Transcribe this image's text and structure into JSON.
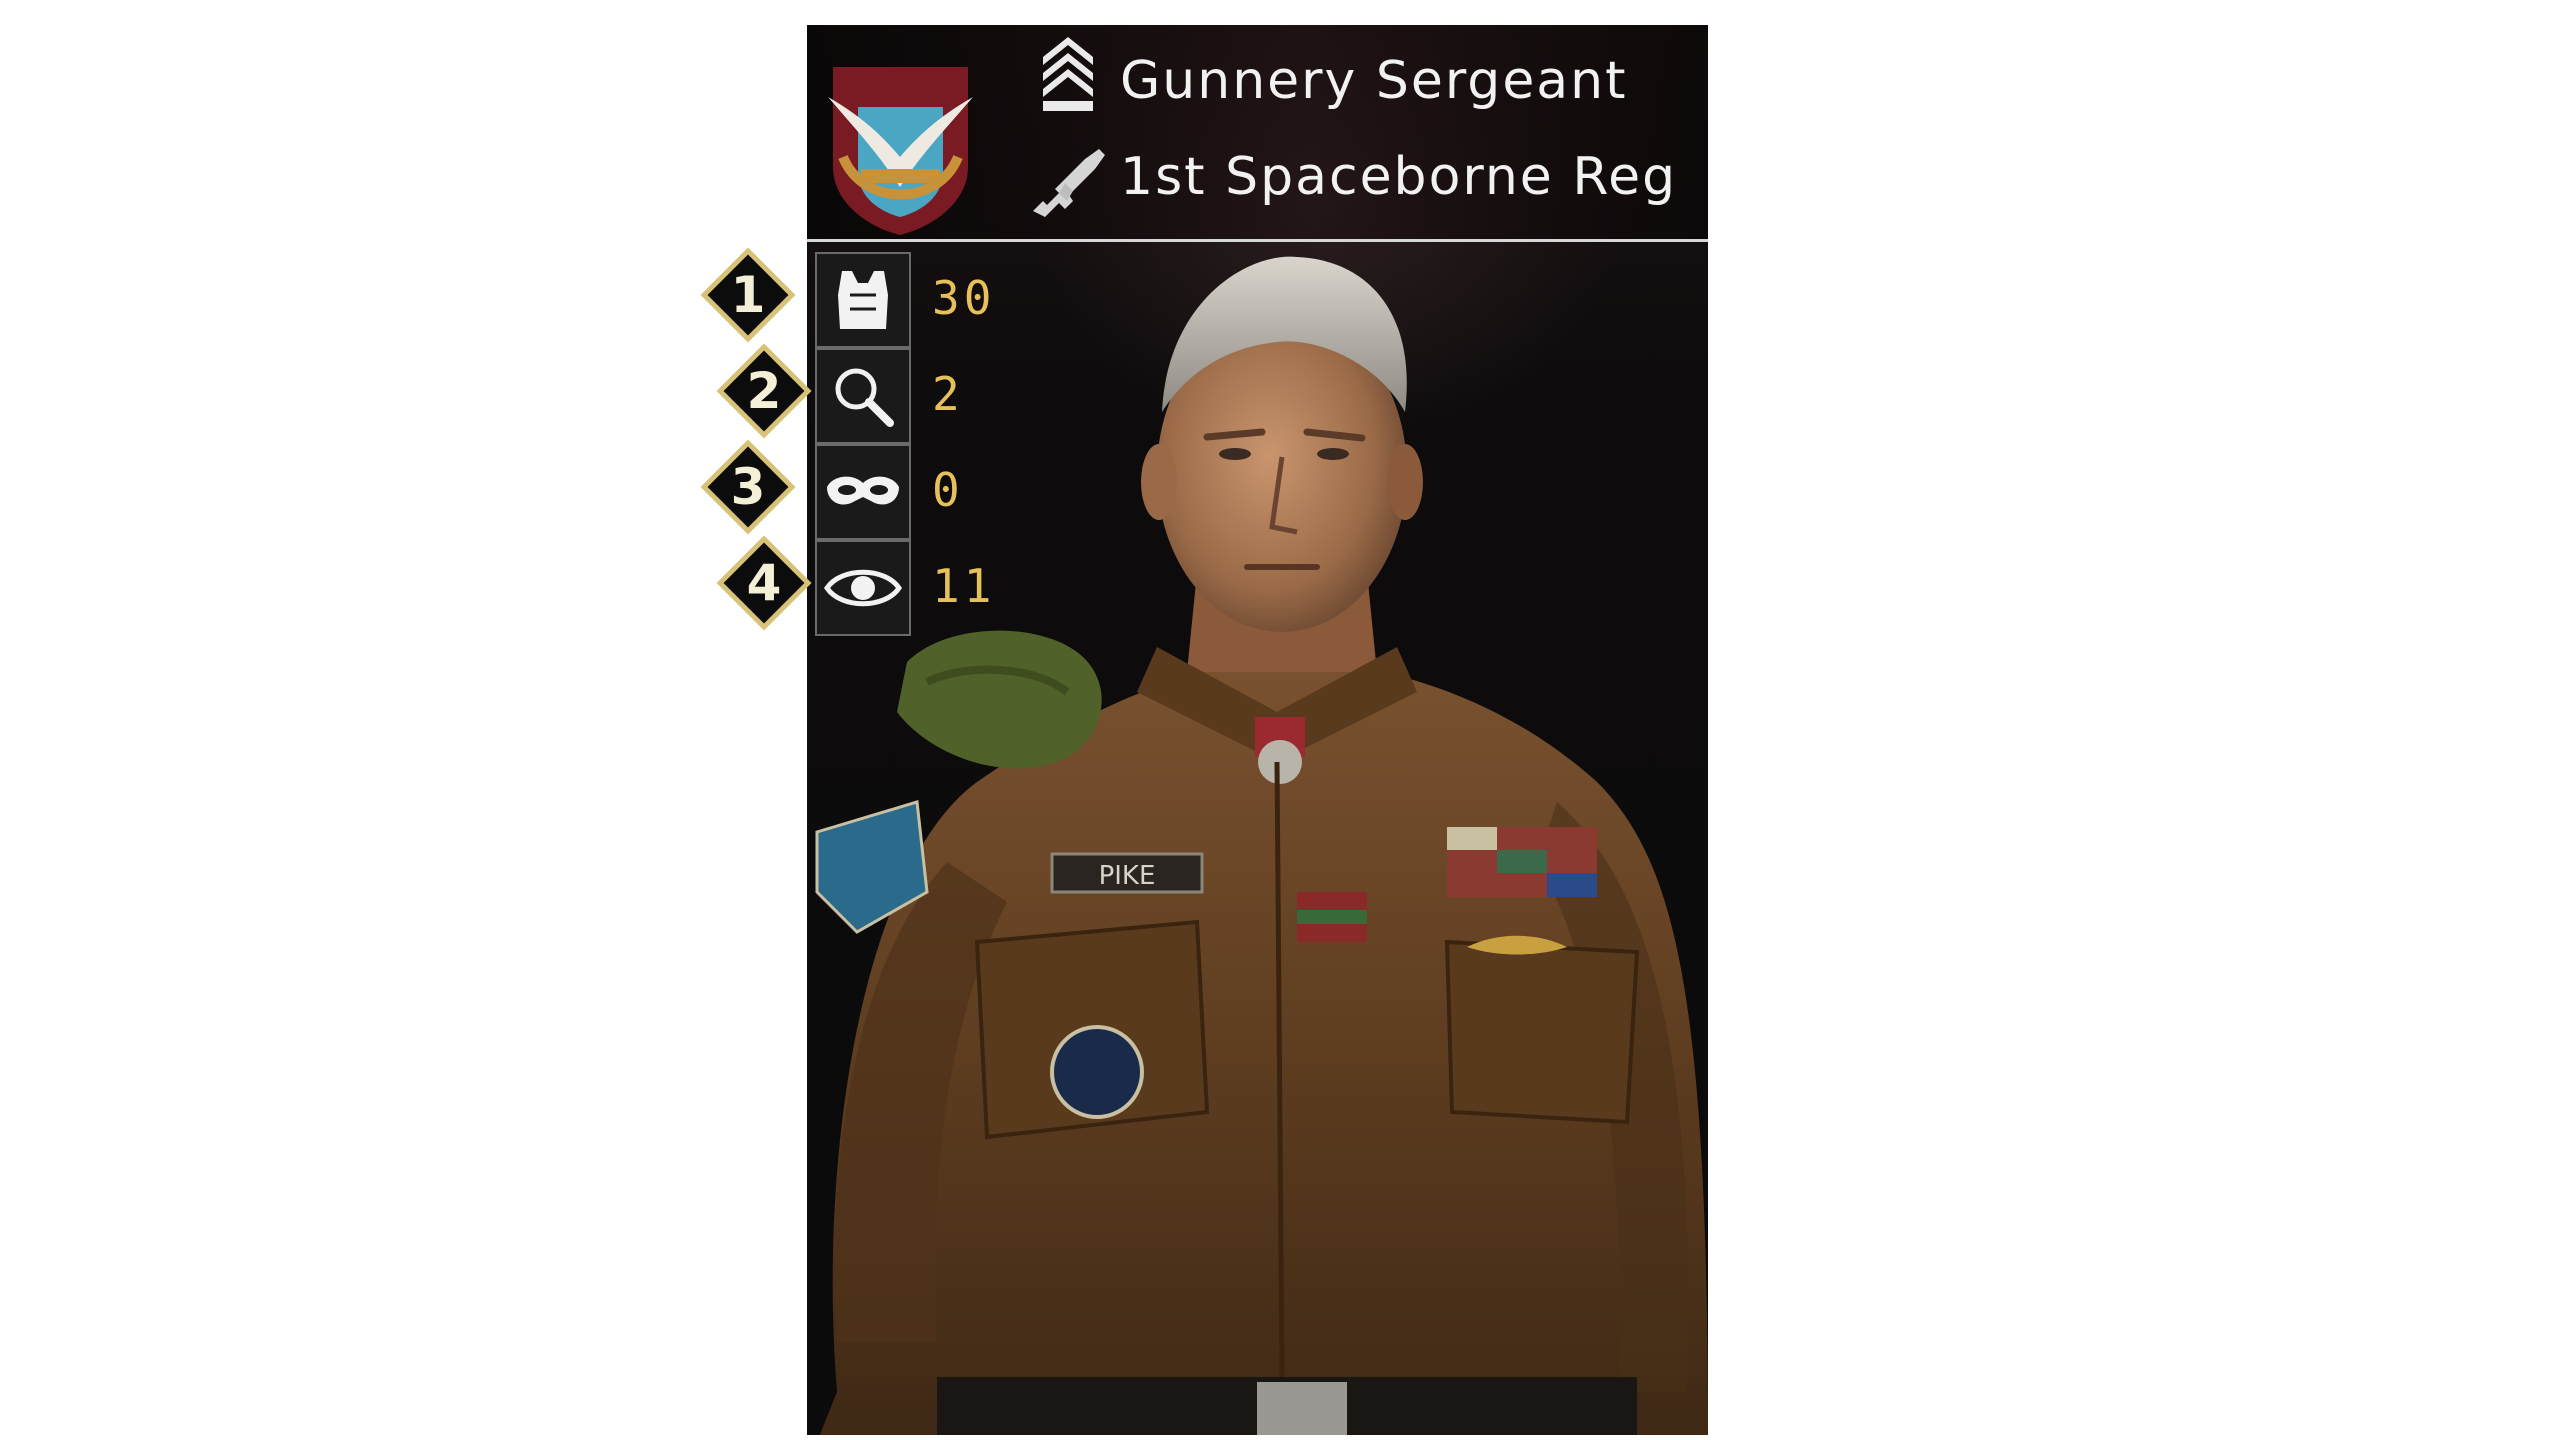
{
  "header": {
    "rank_title": "Gunnery Sergeant",
    "regiment": "1st Spaceborne Reg",
    "emblem_icon": "spaceborne-emblem",
    "rank_icon": "gunnery-sergeant-chevrons-icon",
    "unit_icon": "rifle-icon"
  },
  "portrait": {
    "name_tag": "PIKE"
  },
  "stats": [
    {
      "badge": "1",
      "icon": "body-armor-icon",
      "value": "30"
    },
    {
      "badge": "2",
      "icon": "magnifier-icon",
      "value": "2"
    },
    {
      "badge": "3",
      "icon": "mask-icon",
      "value": "0"
    },
    {
      "badge": "4",
      "icon": "eye-icon",
      "value": "11"
    }
  ],
  "colors": {
    "stat_value": "#e6c05a",
    "badge_border": "#d8c27a",
    "card_background": "#0e0c0d",
    "uniform": "#6b4522"
  }
}
